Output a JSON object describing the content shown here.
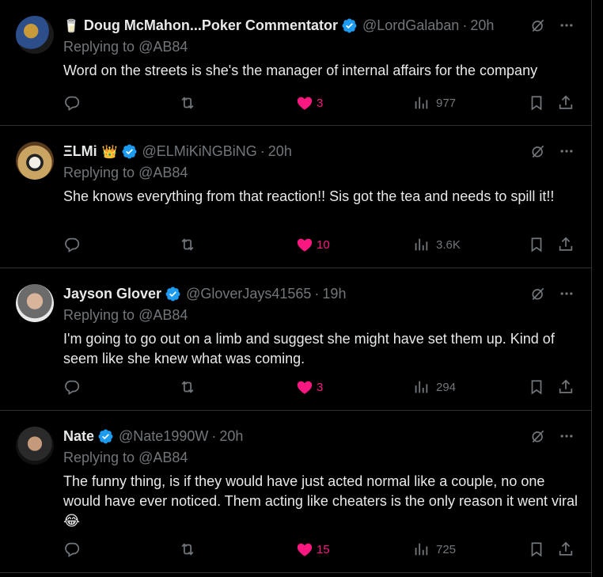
{
  "replies": [
    {
      "name": "Doug McMahon...Poker Commentator",
      "emoji": "🥛",
      "handle": "@LordGalaban",
      "time": "20h",
      "replying_prefix": "Replying to",
      "replying_to": "@AB84",
      "text": "Word on the streets is she's the manager of internal affairs for the company",
      "likes": "3",
      "views": "977"
    },
    {
      "name": "ΞLMi",
      "emoji": "👑",
      "handle": "@ELMiKiNGBiNG",
      "time": "20h",
      "replying_prefix": "Replying to",
      "replying_to": "@AB84",
      "text": "She knows everything from that reaction!! Sis got the tea and needs to spill it!!",
      "likes": "10",
      "views": "3.6K"
    },
    {
      "name": "Jayson Glover",
      "handle": "@GloverJays41565",
      "time": "19h",
      "replying_prefix": "Replying to",
      "replying_to": "@AB84",
      "text": "I'm going to go out on a limb and suggest she might have set them up. Kind of seem like she knew what was coming.",
      "likes": "3",
      "views": "294"
    },
    {
      "name": "Nate",
      "handle": "@Nate1990W",
      "time": "20h",
      "replying_prefix": "Replying to",
      "replying_to": "@AB84",
      "text": "The funny thing, is if they would have just acted normal like a couple, no one would have ever noticed. Them acting like cheaters is the only reason it went viral 😂",
      "likes": "15",
      "views": "725"
    }
  ],
  "colors": {
    "background": "#000000",
    "text": "#e7e9ea",
    "muted": "#71767b",
    "like": "#f91880",
    "verified": "#1d9bf0",
    "divider": "#2f3336"
  },
  "icons": [
    "verified-badge-icon",
    "grok-icon",
    "more-icon",
    "reply-icon",
    "retweet-icon",
    "heart-icon",
    "views-icon",
    "bookmark-icon",
    "share-icon"
  ]
}
